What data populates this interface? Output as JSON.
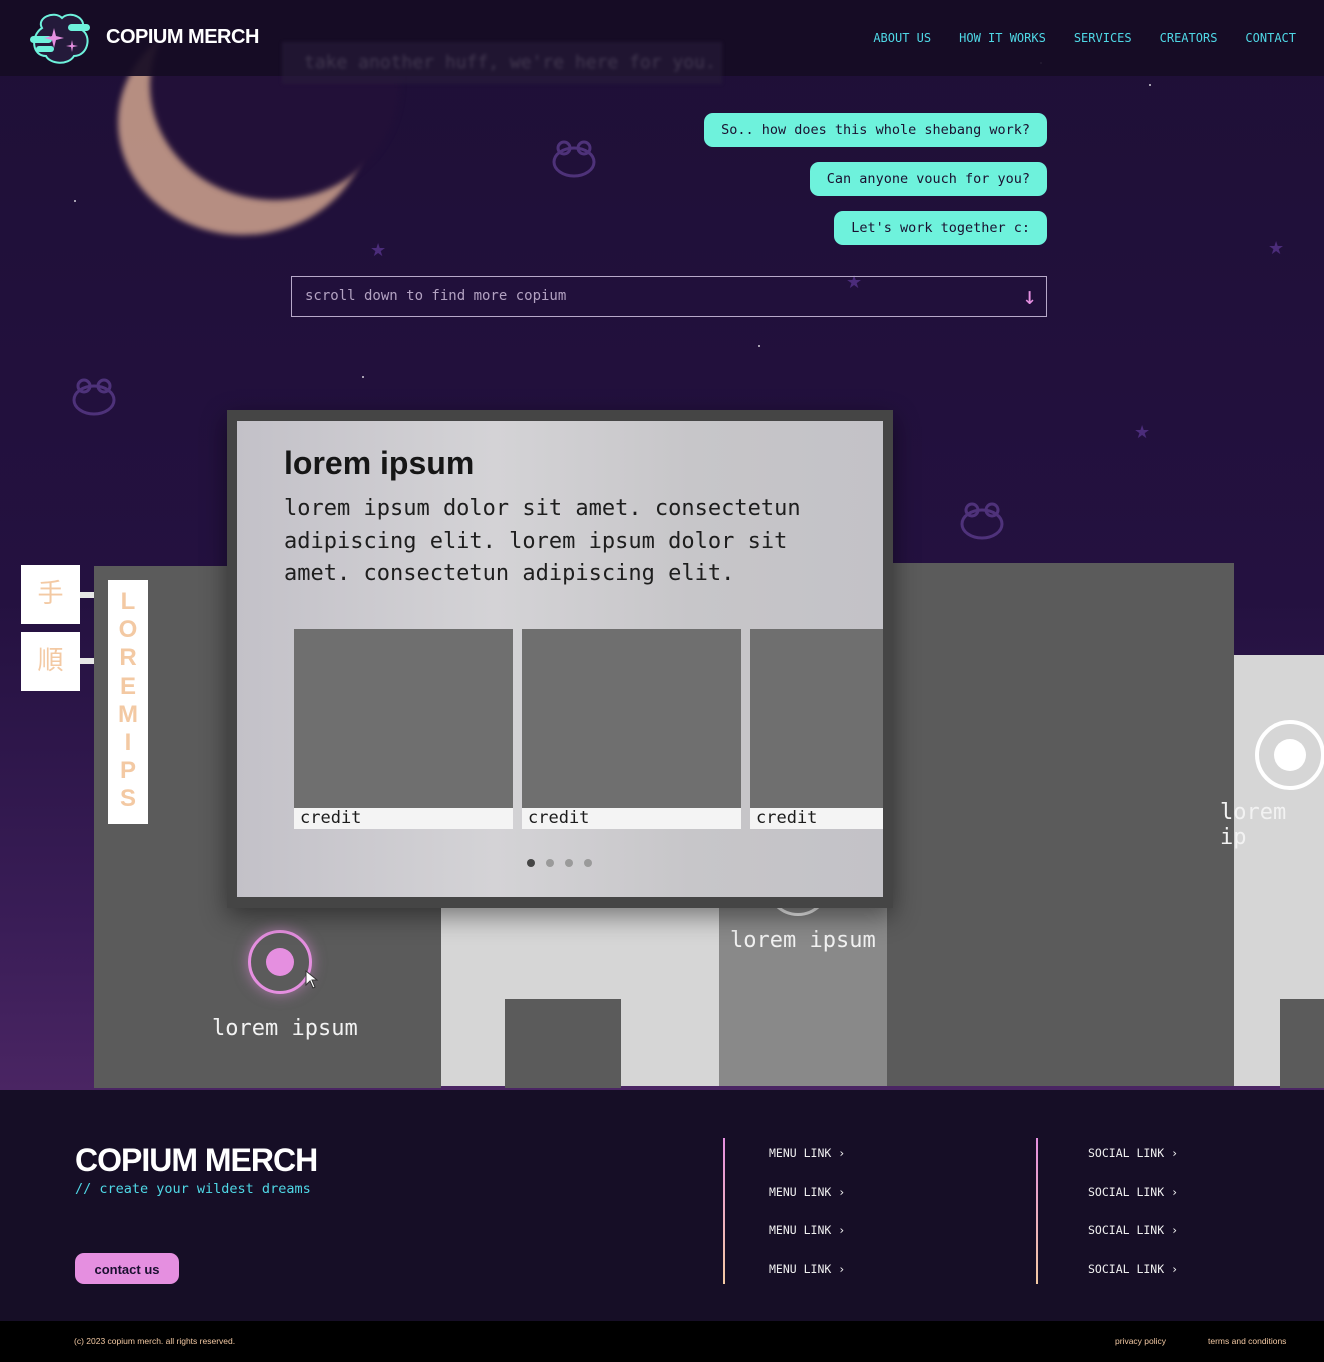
{
  "header": {
    "brand": "COPIUM MERCH",
    "nav": [
      "ABOUT US",
      "HOW IT WORKS",
      "SERVICES",
      "CREATORS",
      "CONTACT"
    ],
    "ghost_text": "take another huff, we're here for you."
  },
  "hero": {
    "bubbles": [
      "So.. how does this whole shebang work?",
      "Can anyone vouch for you?",
      "Let's work together c:"
    ],
    "scroll_placeholder": "scroll down to find more copium",
    "scroll_arrow": "↓"
  },
  "scene": {
    "kanji": [
      "手",
      "順"
    ],
    "vertical_sign": "LOREMIPS",
    "pins": [
      "lorem ipsum",
      "lorem ipsum",
      "lorem ip"
    ]
  },
  "modal": {
    "title": "lorem ipsum",
    "body": "lorem ipsum dolor sit amet. consectetun adipiscing elit. lorem ipsum dolor sit amet. consectetun adipiscing elit.",
    "cards": [
      "credit",
      "credit",
      "credit"
    ],
    "pages": 4,
    "active_page": 1
  },
  "footer": {
    "brand": "COPIUM MERCH",
    "tagline": "// create your wildest dreams",
    "contact_button": "contact us",
    "menu_links": [
      "MENU LINK ›",
      "MENU LINK ›",
      "MENU LINK ›",
      "MENU LINK ›"
    ],
    "social_links": [
      "SOCIAL LINK ›",
      "SOCIAL LINK ›",
      "SOCIAL LINK ›",
      "SOCIAL LINK ›"
    ],
    "copyright": "(c) 2023 copium merch. all rights reserved.",
    "privacy": "privacy policy",
    "terms": "terms and conditions"
  },
  "colors": {
    "accent_teal": "#6ef2dc",
    "accent_pink": "#e58fe0",
    "accent_peach": "#f3c9a3",
    "nav_cyan": "#4fd8e6"
  }
}
